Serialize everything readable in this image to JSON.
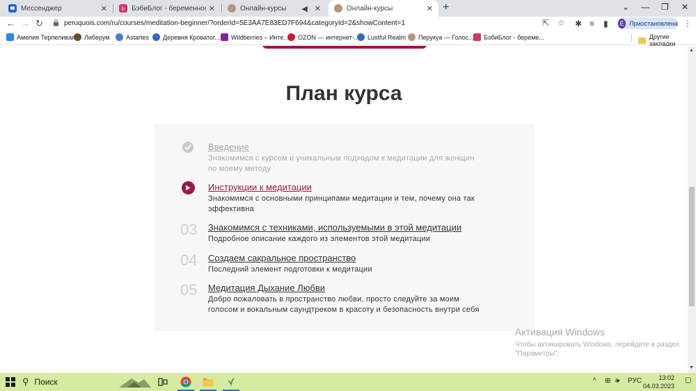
{
  "browser": {
    "tabs": [
      {
        "title": "Мессенджер",
        "icon": "messenger-icon",
        "color": "#1e62d8",
        "active": false
      },
      {
        "title": "БэбиБлог - беременность, кале",
        "icon": "babyblog-icon",
        "color": "#d6336c",
        "active": false
      },
      {
        "title": "Онлайн-курсы",
        "icon": "peruquois-icon",
        "color": "#b99478",
        "active": false
      },
      {
        "title": "Онлайн-курсы",
        "icon": "peruquois-icon",
        "color": "#b99478",
        "active": true
      }
    ],
    "url": "peruquois.com/ru/courses/meditation-beginner/?orderId=5E3AA7E83ED7F694&categoryId=2&showContent=1",
    "profile_initial": "E",
    "profile_label": "Приостановлена",
    "bookmarks": [
      {
        "label": "Амелия Терпеливая",
        "icon": "vk-icon",
        "color": "#2787f5"
      },
      {
        "label": "Либерум",
        "icon": "liberum-icon",
        "color": "#6b4f2a"
      },
      {
        "label": "Astartes",
        "icon": "astartes-icon",
        "color": "#4a7bd0"
      },
      {
        "label": "Деревня Кроватог...",
        "icon": "village-icon",
        "color": "#3a66c4"
      },
      {
        "label": "Wildberries – Инте...",
        "icon": "wildberries-icon",
        "color": "#8b1fa8"
      },
      {
        "label": "OZON — интернет-...",
        "icon": "ozon-icon",
        "color": "#d11b2d"
      },
      {
        "label": "Lustful Realm",
        "icon": "lustful-icon",
        "color": "#3a66c4"
      },
      {
        "label": "Перукуа — Голос...",
        "icon": "peruquois-bookmark-icon",
        "color": "#b99478"
      },
      {
        "label": "БэбиБлог - береме...",
        "icon": "babyblog-bookmark-icon",
        "color": "#d6336c"
      }
    ],
    "other_bookmarks": "Другие закладки"
  },
  "page": {
    "title": "План курса",
    "accent": "#a01545",
    "lessons": [
      {
        "status": "done",
        "marker": "check",
        "title": "Введение",
        "description": "Знакомимся с курсом и уникальным подходом к медитации для женщин по моему методу"
      },
      {
        "status": "current",
        "marker": "play",
        "title": "Инструкции к медитации",
        "description": "Знакомимся с основными принципами медитации и тем, почему она так эффективна"
      },
      {
        "status": "todo",
        "marker": "03",
        "title": "Знакомимся с техниками, используемыми в этой медитации",
        "description": "Подробное описание каждого из элементов этой медитации"
      },
      {
        "status": "todo",
        "marker": "04",
        "title": "Создаем сакральное пространство",
        "description": "Последний элемент подготовки к медитации"
      },
      {
        "status": "todo",
        "marker": "05",
        "title": "Медитация Дыхание Любви",
        "description": "Добро пожаловать в пространство любви, просто следуйте за моим голосом и вокальным саундтреком в красоту и безопасность внутри себя"
      }
    ],
    "activation": {
      "line1": "Активация Windows",
      "line2": "Чтобы активировать Windows, перейдите в раздел",
      "line3": "\"Параметры\"."
    }
  },
  "taskbar": {
    "search_label": "Поиск",
    "language": "РУС",
    "time": "13:02",
    "date": "04.03.2023"
  }
}
